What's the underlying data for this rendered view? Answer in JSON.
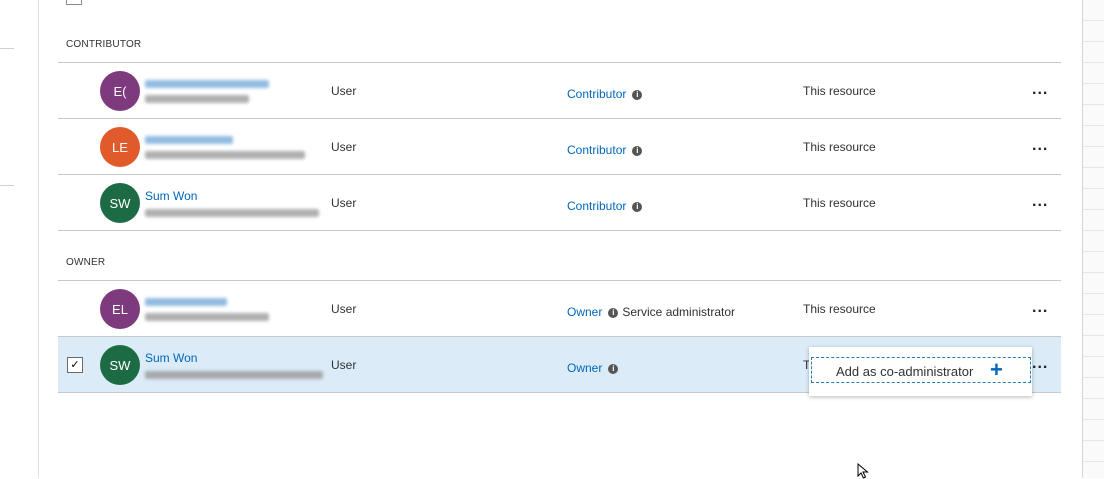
{
  "groups": [
    {
      "header": "CONTRIBUTOR",
      "rows": [
        {
          "initials": "E(",
          "avatar_color": "#7d3a7d",
          "name": "",
          "type": "User",
          "role": "Contributor",
          "role_note": "",
          "scope": "This resource",
          "more": "...",
          "selected": false
        },
        {
          "initials": "LE",
          "avatar_color": "#e05a2b",
          "name": "",
          "type": "User",
          "role": "Contributor",
          "role_note": "",
          "scope": "This resource",
          "more": "...",
          "selected": false
        },
        {
          "initials": "SW",
          "avatar_color": "#1d6b45",
          "name": "Sum Won",
          "type": "User",
          "role": "Contributor",
          "role_note": "",
          "scope": "This resource",
          "more": "...",
          "selected": false
        }
      ]
    },
    {
      "header": "OWNER",
      "rows": [
        {
          "initials": "EL",
          "avatar_color": "#7d3a7d",
          "name": "",
          "type": "User",
          "role": "Owner",
          "role_note": "Service administrator",
          "scope": "This resource",
          "more": "...",
          "selected": false
        },
        {
          "initials": "SW",
          "avatar_color": "#1d6b45",
          "name": "Sum Won",
          "type": "User",
          "role": "Owner",
          "role_note": "",
          "scope": "T",
          "more": "...",
          "selected": true
        }
      ]
    }
  ],
  "info_icon": "i",
  "checkmark": "✓",
  "context_menu": {
    "item_label": "Add as co-administrator",
    "item_icon": "plus-icon",
    "plus_glyph": "+"
  },
  "colors": {
    "link": "#0067b8",
    "selected_row": "#dcebf8"
  }
}
